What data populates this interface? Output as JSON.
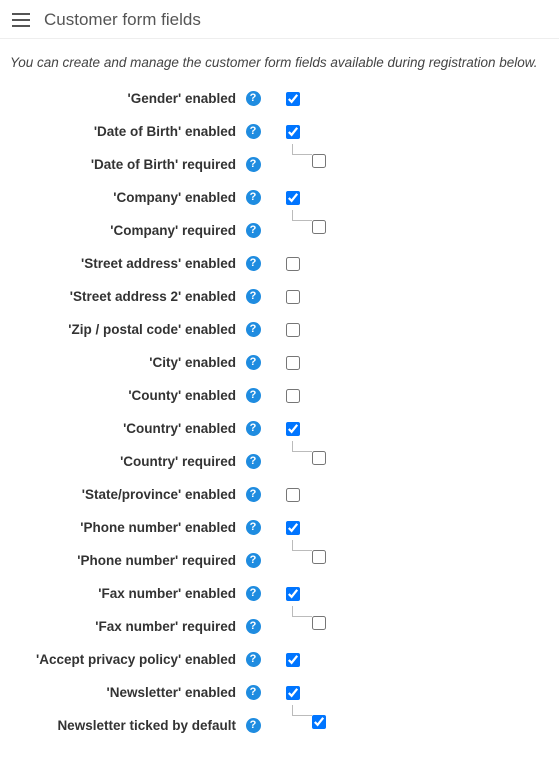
{
  "header": {
    "title": "Customer form fields"
  },
  "description": "You can create and manage the customer form fields available during registration below.",
  "help_glyph": "?",
  "rows": [
    {
      "label": "'Gender' enabled",
      "checked": true,
      "sub": false
    },
    {
      "label": "'Date of Birth' enabled",
      "checked": true,
      "sub": false
    },
    {
      "label": "'Date of Birth' required",
      "checked": false,
      "sub": true
    },
    {
      "label": "'Company' enabled",
      "checked": true,
      "sub": false
    },
    {
      "label": "'Company' required",
      "checked": false,
      "sub": true
    },
    {
      "label": "'Street address' enabled",
      "checked": false,
      "sub": false
    },
    {
      "label": "'Street address 2' enabled",
      "checked": false,
      "sub": false
    },
    {
      "label": "'Zip / postal code' enabled",
      "checked": false,
      "sub": false
    },
    {
      "label": "'City' enabled",
      "checked": false,
      "sub": false
    },
    {
      "label": "'County' enabled",
      "checked": false,
      "sub": false
    },
    {
      "label": "'Country' enabled",
      "checked": true,
      "sub": false
    },
    {
      "label": "'Country' required",
      "checked": false,
      "sub": true
    },
    {
      "label": "'State/province' enabled",
      "checked": false,
      "sub": false
    },
    {
      "label": "'Phone number' enabled",
      "checked": true,
      "sub": false
    },
    {
      "label": "'Phone number' required",
      "checked": false,
      "sub": true
    },
    {
      "label": "'Fax number' enabled",
      "checked": true,
      "sub": false
    },
    {
      "label": "'Fax number' required",
      "checked": false,
      "sub": true
    },
    {
      "label": "'Accept privacy policy' enabled",
      "checked": true,
      "sub": false
    },
    {
      "label": "'Newsletter' enabled",
      "checked": true,
      "sub": false
    },
    {
      "label": "Newsletter ticked by default",
      "checked": true,
      "sub": true
    }
  ]
}
